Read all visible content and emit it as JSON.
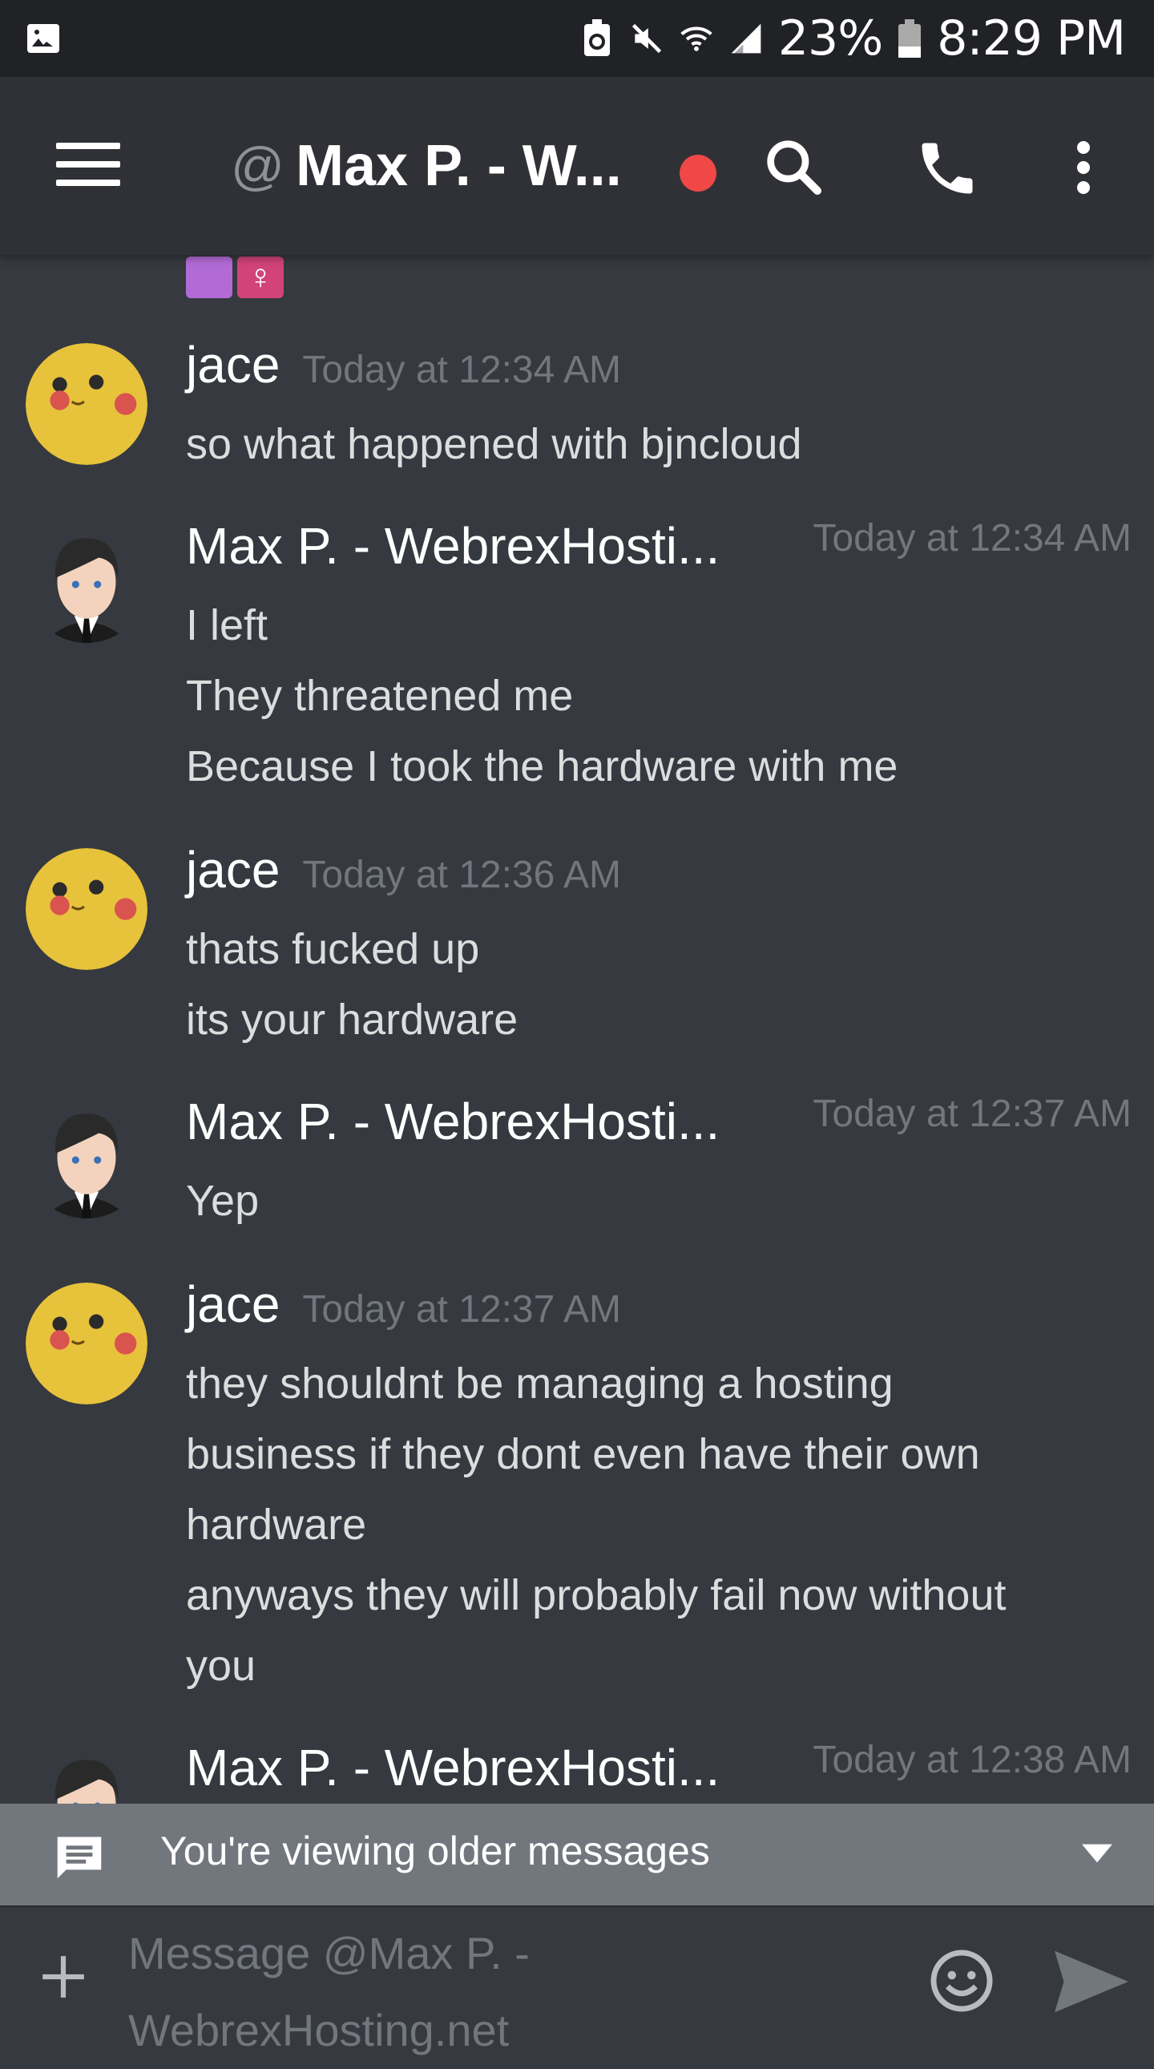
{
  "status_bar": {
    "icons": [
      "image-icon",
      "battery-saver-icon",
      "mute-icon",
      "wifi-icon",
      "signal-icon",
      "battery-icon"
    ],
    "battery_percent": "23%",
    "time": "8:29 PM"
  },
  "header": {
    "at_symbol": "@",
    "channel_name": "Max P. - W...",
    "status_color": "#f04747",
    "icons": [
      "menu-icon",
      "search-icon",
      "phone-icon",
      "more-vert-icon"
    ]
  },
  "messages": {
    "top_emojis": [
      "🤷",
      "♀"
    ],
    "items": [
      {
        "author": "jace",
        "timestamp": "Today at 12:34 AM",
        "avatar": "pikachu-avatar",
        "lines": [
          "so what happened with bjncloud"
        ]
      },
      {
        "author": "Max P. - WebrexHosti...",
        "timestamp": "Today at 12:34 AM",
        "avatar": "businessman-avatar",
        "lines": [
          "I left",
          "They threatened me",
          "Because I took the hardware with me"
        ]
      },
      {
        "author": "jace",
        "timestamp": "Today at 12:36 AM",
        "avatar": "pikachu-avatar",
        "lines": [
          "thats fucked up",
          "its your hardware"
        ]
      },
      {
        "author": "Max P. - WebrexHosti...",
        "timestamp": "Today at 12:37 AM",
        "avatar": "businessman-avatar",
        "lines": [
          "Yep"
        ]
      },
      {
        "author": "jace",
        "timestamp": "Today at 12:37 AM",
        "avatar": "pikachu-avatar",
        "lines": [
          "they shouldnt be managing a hosting",
          "business if they dont even have their own",
          "hardware",
          "anyways they will probably fail now without",
          "you"
        ]
      },
      {
        "author": "Max P. - WebrexHosti...",
        "timestamp": "Today at 12:38 AM",
        "avatar": "businessman-avatar",
        "lines": []
      }
    ]
  },
  "older_bar": {
    "text": "You're viewing older messages"
  },
  "composer": {
    "placeholder_line1": "Message @Max P. -",
    "placeholder_line2": "WebrexHosting.net"
  },
  "colors": {
    "background": "#36393f",
    "header": "#2f3136",
    "status_bar": "#202225",
    "older_bar": "#72767d",
    "timestamp": "#72767d"
  }
}
